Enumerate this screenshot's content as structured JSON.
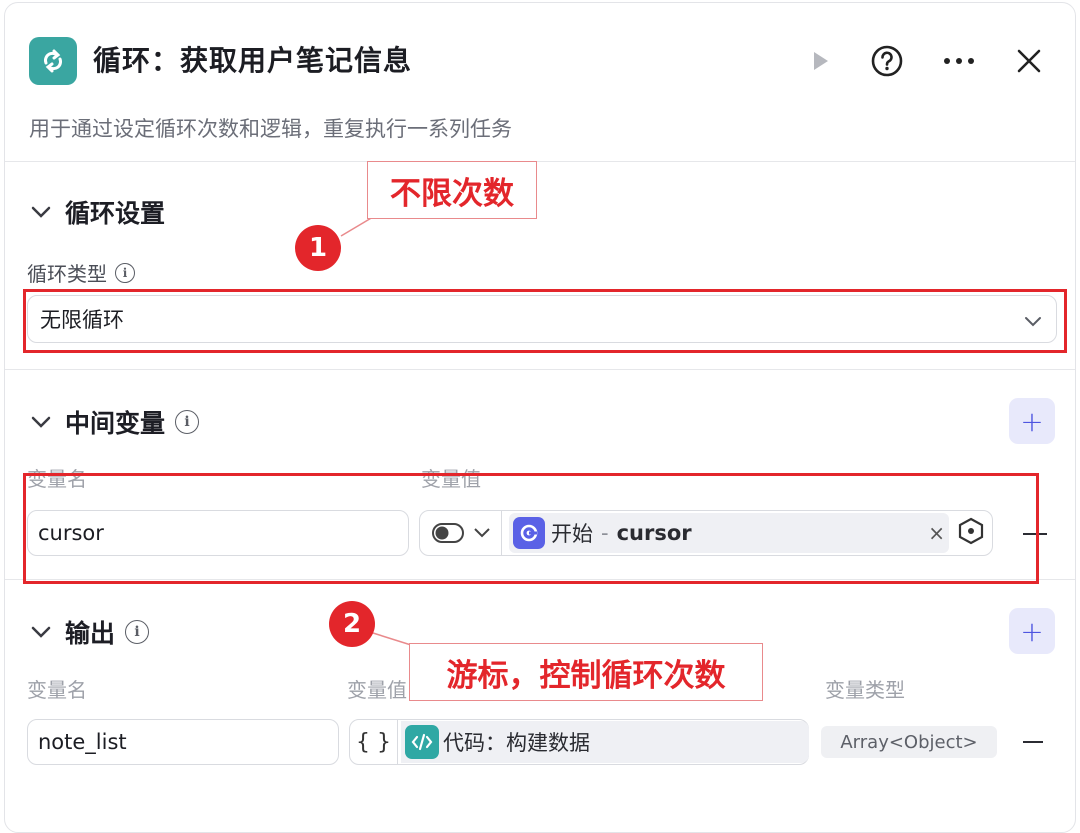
{
  "header": {
    "title": "循环：获取用户笔记信息",
    "description": "用于通过设定循环次数和逻辑，重复执行一系列任务",
    "icons": [
      "loop-icon",
      "play-icon",
      "help-icon",
      "more-icon",
      "close-icon"
    ]
  },
  "loop_settings": {
    "section_title": "循环设置",
    "loop_type_label": "循环类型",
    "loop_type_value": "无限循环"
  },
  "intermediate_vars": {
    "section_title": "中间变量",
    "col_name": "变量名",
    "col_value": "变量值",
    "row": {
      "name": "cursor",
      "ref_node": "开始",
      "ref_separator": "-",
      "ref_var": "cursor",
      "clear": "×"
    }
  },
  "output": {
    "section_title": "输出",
    "col_name": "变量名",
    "col_value": "变量值",
    "col_type": "变量类型",
    "row": {
      "name": "note_list",
      "brace": "{ }",
      "ref": "代码：构建数据",
      "type": "Array<Object>"
    }
  },
  "annotations": {
    "label1": "不限次数",
    "num1": "1",
    "label2": "游标，控制循环次数",
    "num2": "2",
    "color": "#e3262b"
  },
  "colors": {
    "accent": "#5a61e6",
    "teal": "#3aa6a1"
  }
}
